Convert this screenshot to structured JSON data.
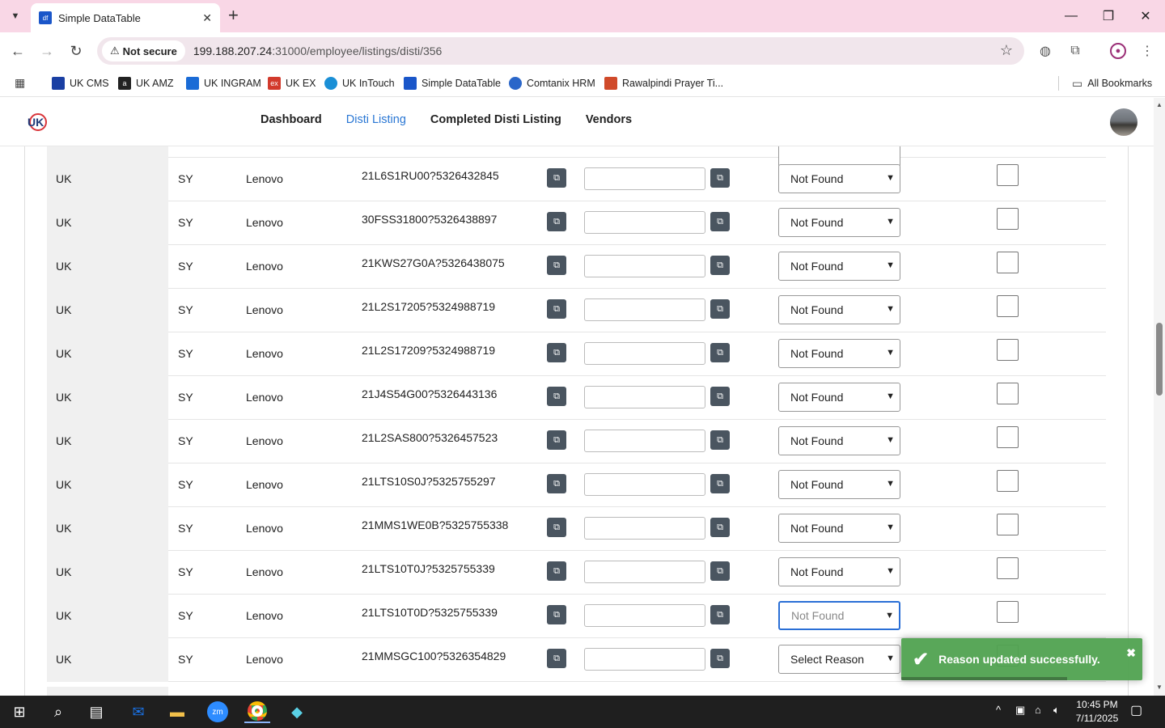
{
  "browser": {
    "tab_title": "Simple DataTable",
    "tab_favicon": "df",
    "not_secure": "Not secure",
    "url_host": "199.188.207.24",
    "url_path": ":31000/employee/listings/disti/356"
  },
  "bookmarks": [
    {
      "label": "UK CMS",
      "color": "#1a3fa3"
    },
    {
      "label": "UK AMZ",
      "color": "#222222"
    },
    {
      "label": "UK INGRAM",
      "color": "#1a6bd6"
    },
    {
      "label": "UK EX",
      "color": "#d23a2c"
    },
    {
      "label": "UK InTouch",
      "color": "#1a8fd6"
    },
    {
      "label": "Simple DataTable",
      "color": "#1a56c9"
    },
    {
      "label": "Comtanix HRM",
      "color": "#2a66c9"
    },
    {
      "label": "Rawalpindi Prayer Ti...",
      "color": "#d04a2a"
    }
  ],
  "all_bookmarks": "All Bookmarks",
  "nav": {
    "items": [
      "Dashboard",
      "Disti Listing",
      "Completed Disti Listing",
      "Vendors"
    ],
    "active": "Disti Listing"
  },
  "table": {
    "rows": [
      {
        "country": "UK",
        "code": "SY",
        "vendor": "Lenovo",
        "sku": "21L6S1RU00?5326432845",
        "reason": "Not Found"
      },
      {
        "country": "UK",
        "code": "SY",
        "vendor": "Lenovo",
        "sku": "30FSS31800?5326438897",
        "reason": "Not Found"
      },
      {
        "country": "UK",
        "code": "SY",
        "vendor": "Lenovo",
        "sku": "21KWS27G0A?5326438075",
        "reason": "Not Found"
      },
      {
        "country": "UK",
        "code": "SY",
        "vendor": "Lenovo",
        "sku": "21L2S17205?5324988719",
        "reason": "Not Found"
      },
      {
        "country": "UK",
        "code": "SY",
        "vendor": "Lenovo",
        "sku": "21L2S17209?5324988719",
        "reason": "Not Found"
      },
      {
        "country": "UK",
        "code": "SY",
        "vendor": "Lenovo",
        "sku": "21J4S54G00?5326443136",
        "reason": "Not Found"
      },
      {
        "country": "UK",
        "code": "SY",
        "vendor": "Lenovo",
        "sku": "21L2SAS800?5326457523",
        "reason": "Not Found"
      },
      {
        "country": "UK",
        "code": "SY",
        "vendor": "Lenovo",
        "sku": "21LTS10S0J?5325755297",
        "reason": "Not Found"
      },
      {
        "country": "UK",
        "code": "SY",
        "vendor": "Lenovo",
        "sku": "21MMS1WE0B?5325755338",
        "reason": "Not Found"
      },
      {
        "country": "UK",
        "code": "SY",
        "vendor": "Lenovo",
        "sku": "21LTS10T0J?5325755339",
        "reason": "Not Found"
      },
      {
        "country": "UK",
        "code": "SY",
        "vendor": "Lenovo",
        "sku": "21LTS10T0D?5325755339",
        "reason": "Not Found"
      },
      {
        "country": "UK",
        "code": "SY",
        "vendor": "Lenovo",
        "sku": "21MMSGC100?5326354829",
        "reason": "Select Reason"
      }
    ]
  },
  "toast": {
    "message": "Reason updated successfully.",
    "color": "#51a351"
  },
  "taskbar": {
    "time": "10:45 PM",
    "date": "7/11/2025"
  },
  "colors": {
    "accent": "#2a77d4",
    "tab_strip": "#f9d7e6"
  }
}
